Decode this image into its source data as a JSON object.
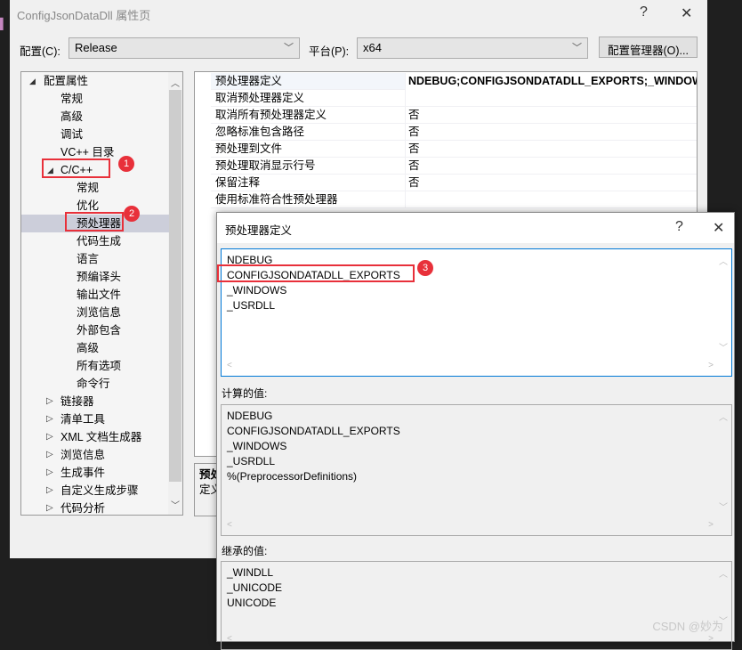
{
  "window": {
    "title": "ConfigJsonDataDll 属性页",
    "help": "?",
    "close": "✕"
  },
  "toolbar": {
    "config_label": "配置(C):",
    "config_value": "Release",
    "platform_label": "平台(P):",
    "platform_value": "x64",
    "config_manager": "配置管理器(O)..."
  },
  "tree": {
    "root": "配置属性",
    "items": [
      {
        "label": "常规",
        "level": 1
      },
      {
        "label": "高级",
        "level": 1
      },
      {
        "label": "调试",
        "level": 1
      },
      {
        "label": "VC++ 目录",
        "level": 1
      },
      {
        "label": "C/C++",
        "level": 1,
        "expanded": true
      },
      {
        "label": "常规",
        "level": 2
      },
      {
        "label": "优化",
        "level": 2
      },
      {
        "label": "预处理器",
        "level": 2,
        "selected": true
      },
      {
        "label": "代码生成",
        "level": 2
      },
      {
        "label": "语言",
        "level": 2
      },
      {
        "label": "预编译头",
        "level": 2
      },
      {
        "label": "输出文件",
        "level": 2
      },
      {
        "label": "浏览信息",
        "level": 2
      },
      {
        "label": "外部包含",
        "level": 2
      },
      {
        "label": "高级",
        "level": 2
      },
      {
        "label": "所有选项",
        "level": 2
      },
      {
        "label": "命令行",
        "level": 2
      },
      {
        "label": "链接器",
        "level": 1,
        "collapsed": true
      },
      {
        "label": "清单工具",
        "level": 1,
        "collapsed": true
      },
      {
        "label": "XML 文档生成器",
        "level": 1,
        "collapsed": true
      },
      {
        "label": "浏览信息",
        "level": 1,
        "collapsed": true
      },
      {
        "label": "生成事件",
        "level": 1,
        "collapsed": true
      },
      {
        "label": "自定义生成步骤",
        "level": 1,
        "collapsed": true
      },
      {
        "label": "代码分析",
        "level": 1,
        "collapsed": true
      }
    ]
  },
  "grid": {
    "rows": [
      {
        "name": "预处理器定义",
        "value": "NDEBUG;CONFIGJSONDATADLL_EXPORTS;_WINDOW"
      },
      {
        "name": "取消预处理器定义",
        "value": ""
      },
      {
        "name": "取消所有预处理器定义",
        "value": "否"
      },
      {
        "name": "忽略标准包含路径",
        "value": "否"
      },
      {
        "name": "预处理到文件",
        "value": "否"
      },
      {
        "name": "预处理取消显示行号",
        "value": "否"
      },
      {
        "name": "保留注释",
        "value": "否"
      },
      {
        "name": "使用标准符合性预处理器",
        "value": ""
      }
    ]
  },
  "desc": {
    "title": "预处",
    "text": "定义"
  },
  "dialog": {
    "title": "预处理器定义",
    "help": "?",
    "close": "✕",
    "lines": [
      "NDEBUG",
      "CONFIGJSONDATADLL_EXPORTS",
      "_WINDOWS",
      "_USRDLL"
    ],
    "computed_label": "计算的值:",
    "computed": [
      "NDEBUG",
      "CONFIGJSONDATADLL_EXPORTS",
      "_WINDOWS",
      "_USRDLL",
      "%(PreprocessorDefinitions)"
    ],
    "inherited_label": "继承的值:",
    "inherited": [
      "_WINDLL",
      "_UNICODE",
      "UNICODE"
    ]
  },
  "annotations": [
    "1",
    "2",
    "3"
  ],
  "watermark": "CSDN @妙为",
  "colors": {
    "highlight": "#e8303a",
    "selection": "#ccceda",
    "focus_border": "#0078d7"
  }
}
